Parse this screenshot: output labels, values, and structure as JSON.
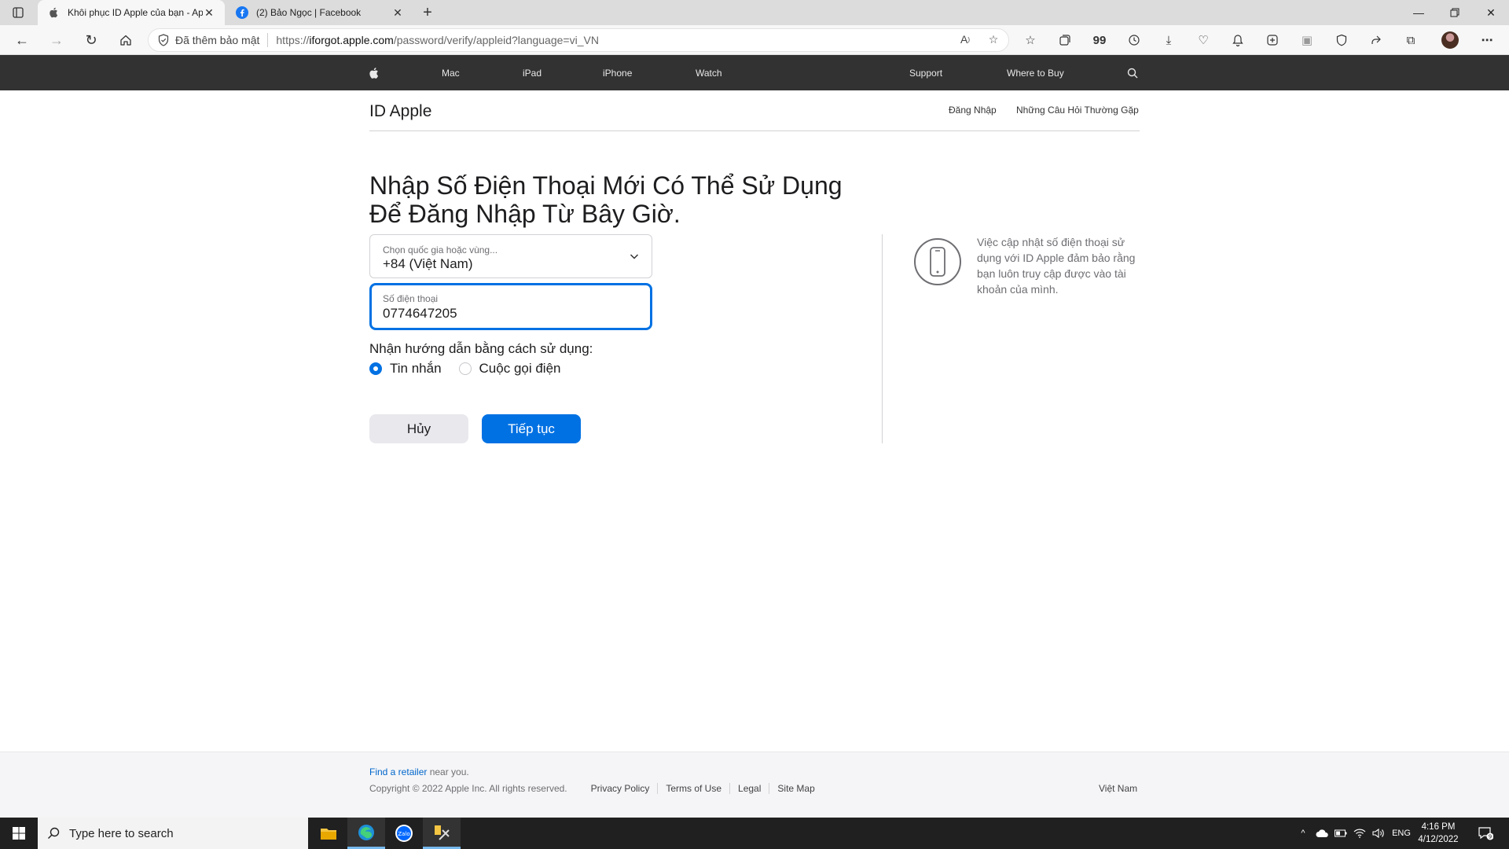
{
  "browser": {
    "tabs": [
      {
        "title": "Khôi phục ID Apple của bạn - Ap",
        "active": true
      },
      {
        "title": "(2) Bảo Ngọc | Facebook",
        "active": false
      }
    ],
    "address": {
      "security_label": "Đã thêm bảo mật",
      "url_prefix": "https://",
      "url_host": "iforgot.apple.com",
      "url_path": "/password/verify/appleid?language=vi_VN"
    }
  },
  "globalnav": {
    "items": [
      "Mac",
      "iPad",
      "iPhone",
      "Watch",
      "Support",
      "Where to Buy"
    ]
  },
  "localnav": {
    "title": "ID Apple",
    "links": [
      "Đăng Nhập",
      "Những Câu Hỏi Thường Gặp"
    ]
  },
  "main": {
    "headline_line1": "Nhập Số Điện Thoại Mới Có Thể Sử Dụng",
    "headline_line2": "Để Đăng Nhập Từ Bây Giờ.",
    "country_label": "Chọn quốc gia hoặc vùng...",
    "country_value": "+84 (Việt Nam)",
    "phone_label": "Số điện thoại",
    "phone_value": "0774647205",
    "method_label": "Nhận hướng dẫn bằng cách sử dụng:",
    "method_options": [
      "Tin nhắn",
      "Cuộc gọi điện"
    ],
    "method_selected": "Tin nhắn",
    "cancel_label": "Hủy",
    "continue_label": "Tiếp tục",
    "side_text": "Việc cập nhật số điện thoại sử dụng với ID Apple đảm bảo rằng bạn luôn truy cập được vào tài khoản của mình."
  },
  "footer": {
    "retailer_link": "Find a retailer",
    "retailer_suffix": " near you.",
    "copyright": "Copyright © 2022 Apple Inc. All rights reserved.",
    "links": [
      "Privacy Policy",
      "Terms of Use",
      "Legal",
      "Site Map"
    ],
    "region": "Việt Nam"
  },
  "taskbar": {
    "search_placeholder": "Type here to search",
    "language": "ENG",
    "time": "4:16 PM",
    "date": "4/12/2022",
    "notification_count": "9"
  },
  "colors": {
    "accent": "#0071e3",
    "globalnav_bg": "#323232",
    "footer_bg": "#f5f5f7"
  }
}
